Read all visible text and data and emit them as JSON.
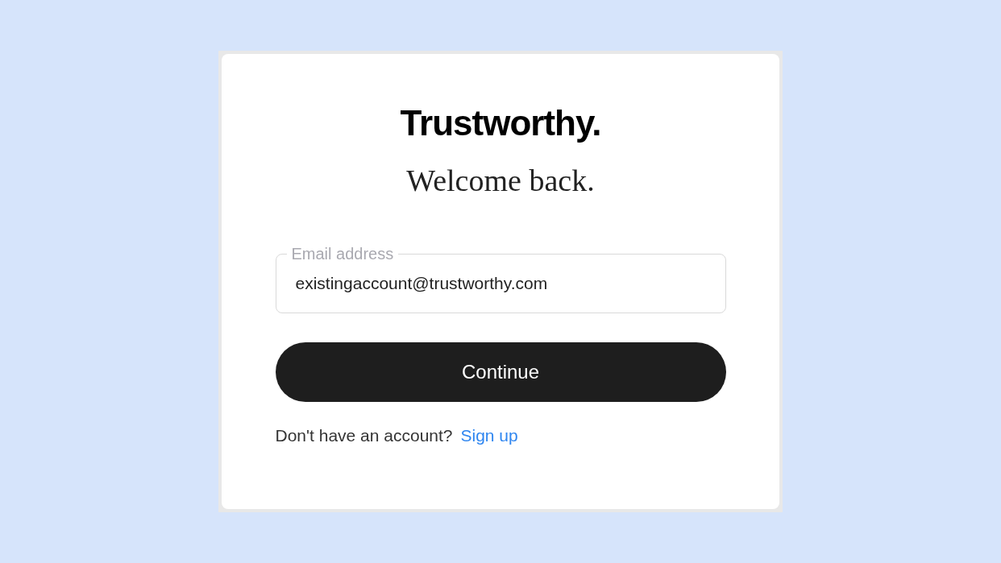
{
  "logo": "Trustworthy.",
  "heading": "Welcome back.",
  "email_field": {
    "label": "Email address",
    "value": "existingaccount@trustworthy.com"
  },
  "continue_button": "Continue",
  "footer": {
    "text": "Don't have an account?",
    "link": "Sign up"
  }
}
